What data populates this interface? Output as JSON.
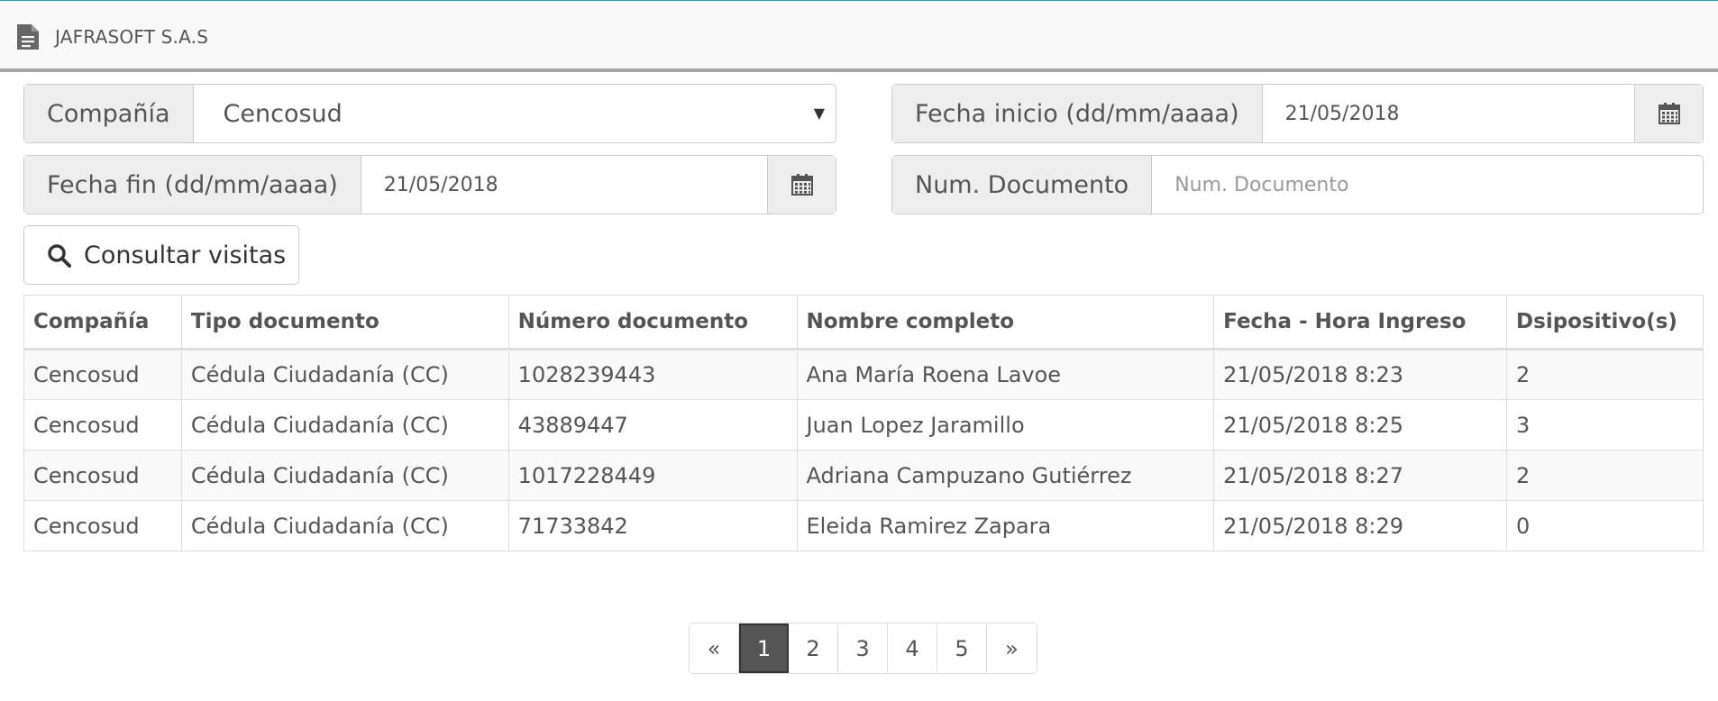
{
  "header": {
    "brand": "JAFRASOFT S.A.S"
  },
  "filters": {
    "company_label": "Compañía",
    "company_value": "Cencosud",
    "start_label": "Fecha inicio (dd/mm/aaaa)",
    "start_value": "21/05/2018",
    "end_label": "Fecha fin (dd/mm/aaaa)",
    "end_value": "21/05/2018",
    "doc_label": "Num. Documento",
    "doc_placeholder": "Num. Documento",
    "search_label": "Consultar visitas"
  },
  "table": {
    "headers": [
      "Compañía",
      "Tipo documento",
      "Número documento",
      "Nombre completo",
      "Fecha - Hora Ingreso",
      "Dsipositivo(s)"
    ],
    "rows": [
      [
        "Cencosud",
        "Cédula Ciudadanía (CC)",
        "1028239443",
        "Ana María Roena Lavoe",
        "21/05/2018 8:23",
        "2"
      ],
      [
        "Cencosud",
        "Cédula Ciudadanía (CC)",
        "43889447",
        "Juan Lopez Jaramillo",
        "21/05/2018 8:25",
        "3"
      ],
      [
        "Cencosud",
        "Cédula Ciudadanía (CC)",
        "1017228449",
        "Adriana Campuzano Gutiérrez",
        "21/05/2018 8:27",
        "2"
      ],
      [
        "Cencosud",
        "Cédula Ciudadanía (CC)",
        "71733842",
        "Eleida Ramirez Zapara",
        "21/05/2018 8:29",
        "0"
      ]
    ]
  },
  "pagination": {
    "prev": "«",
    "pages": [
      "1",
      "2",
      "3",
      "4",
      "5"
    ],
    "next": "»",
    "active": "1"
  },
  "icons": {
    "brand": "document-icon",
    "calendar": "calendar-icon",
    "search": "search-icon"
  },
  "colors": {
    "active_page": "#555555",
    "navbar_border": "#a6a6a6",
    "stripe": "#f9f9f9"
  }
}
